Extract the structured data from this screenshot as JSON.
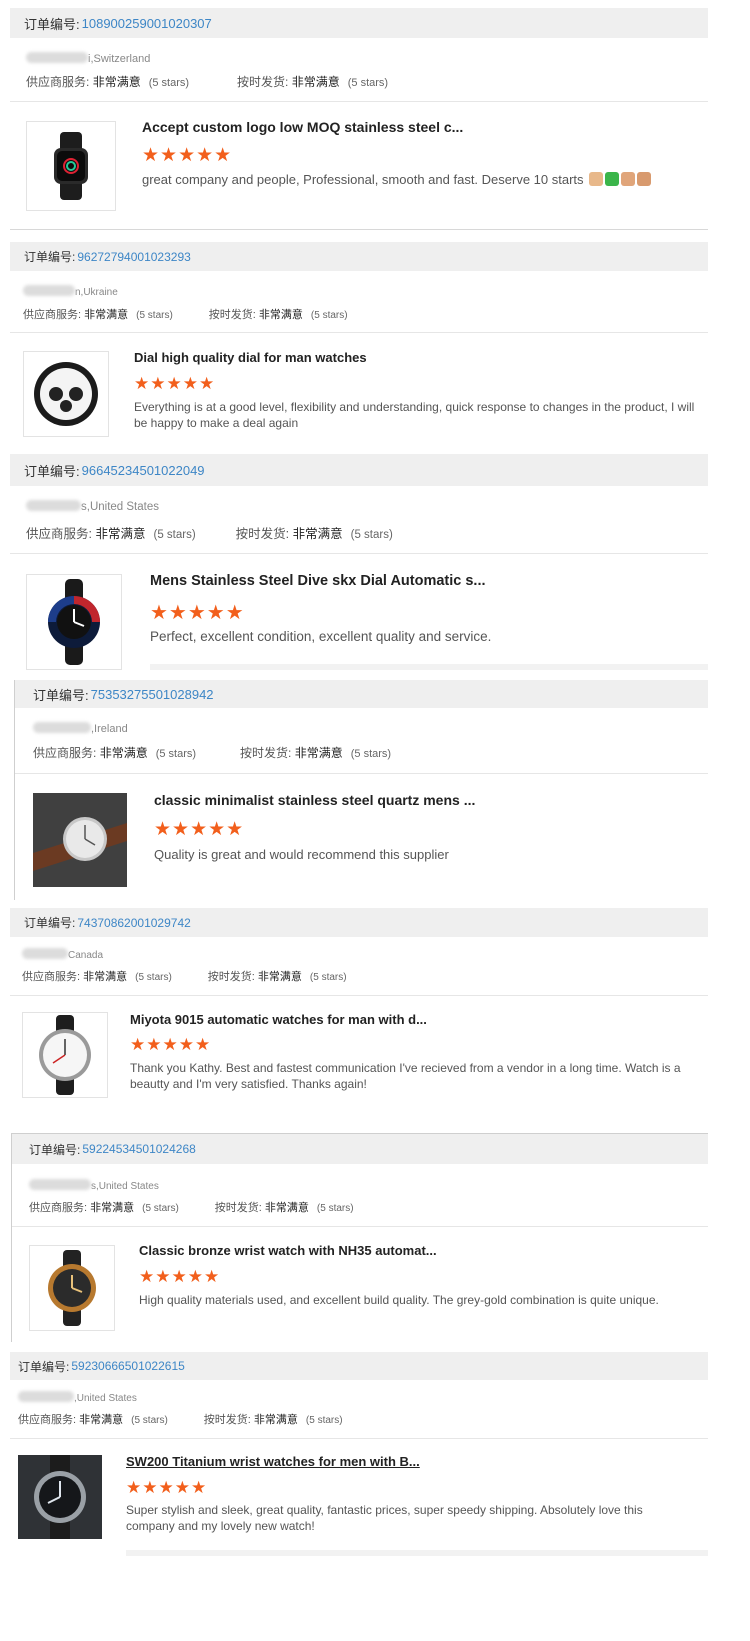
{
  "labels": {
    "order_no": "订单编号:",
    "supplier_service": "供应商服务:",
    "on_time_delivery": "按时发货:",
    "rating_value": "非常满意",
    "rating_stars": "(5 stars)",
    "stars_glyph": "★★★★★"
  },
  "reviews": [
    {
      "order_id": "108900259001020307",
      "location": "i,Switzerland",
      "title": "Accept custom logo low MOQ stainless steel c...",
      "text": "great company and people, Professional, smooth and fast. Deserve 10 starts",
      "emoji": [
        "thumbs-up-icon",
        "check-mark-icon",
        "ok-hand-icon",
        "flexed-biceps-icon"
      ]
    },
    {
      "order_id": "96272794001023293",
      "location": "n,Ukraine",
      "title": "Dial high quality dial for man watches",
      "text": "Everything is at a good level, flexibility and understanding, quick response to changes in the product, I will be happy to make a deal again"
    },
    {
      "order_id": "96645234501022049",
      "location": "s,United States",
      "title": "Mens Stainless Steel Dive skx Dial Automatic s...",
      "text": "Perfect, excellent condition, excellent quality and service."
    },
    {
      "order_id": "75353275501028942",
      "location": ",Ireland",
      "title": "classic minimalist stainless steel quartz mens ...",
      "text": "Quality is great and would recommend this supplier"
    },
    {
      "order_id": "74370862001029742",
      "location": "Canada",
      "title": "Miyota 9015 automatic watches for man with d...",
      "text": "Thank you Kathy. Best and fastest communication I've recieved from a vendor in a long time. Watch is a beautty and I'm very satisfied. Thanks again!"
    },
    {
      "order_id": "59224534501024268",
      "location": "s,United States",
      "title": "Classic bronze wrist watch with NH35 automat...",
      "text": "High quality materials used, and excellent build quality. The grey-gold combination is quite unique."
    },
    {
      "order_id": "59230666501022615",
      "location": ",United States",
      "title": "SW200 Titanium wrist watches for men with B...",
      "text": "Super stylish and sleek, great quality, fantastic prices, super speedy shipping. Absolutely love this company and my lovely new watch!"
    }
  ]
}
